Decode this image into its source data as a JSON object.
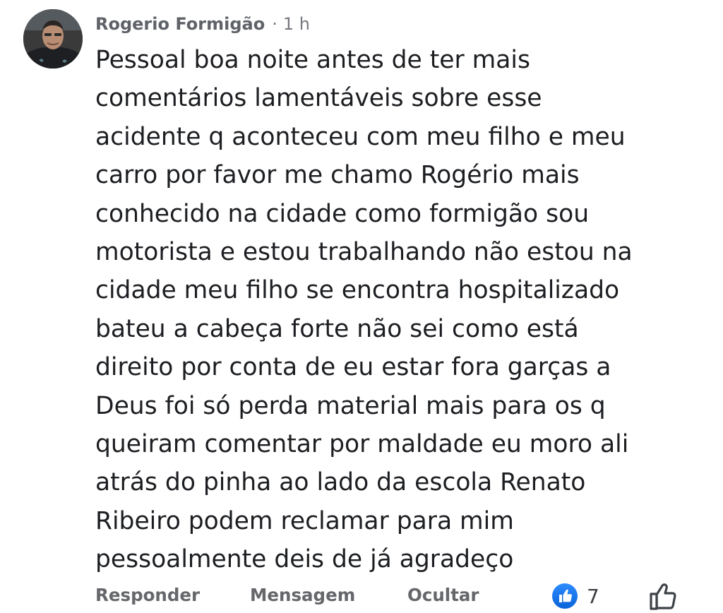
{
  "comment": {
    "author": "Rogerio Formigão",
    "separator": "·",
    "time": "1 h",
    "text": "Pessoal boa noite antes de ter mais\ncomentários lamentáveis sobre esse\nacidente q aconteceu com meu filho e meu\ncarro por favor me chamo Rogério mais\nconhecido na cidade como formigão sou\nmotorista e estou trabalhando não estou na\ncidade meu filho se encontra hospitalizado\nbateu a cabeça forte não sei como está\ndireito por conta de eu estar fora garças a\nDeus foi só perda material mais para os q\nqueiram comentar por maldade eu moro ali\natrás do pinha ao lado da escola Renato\nRibeiro podem reclamar para mim\npessoalmente deis de já agradeço"
  },
  "actions": {
    "reply_label": "Responder",
    "message_label": "Mensagem",
    "hide_label": "Ocultar",
    "reaction_count": "7",
    "reaction_icon": "like-badge-icon",
    "like_icon": "thumbs-up-outline-icon"
  },
  "colors": {
    "like_blue": "#1b74e4",
    "text": "#1c1e21",
    "secondary": "#65676b"
  }
}
